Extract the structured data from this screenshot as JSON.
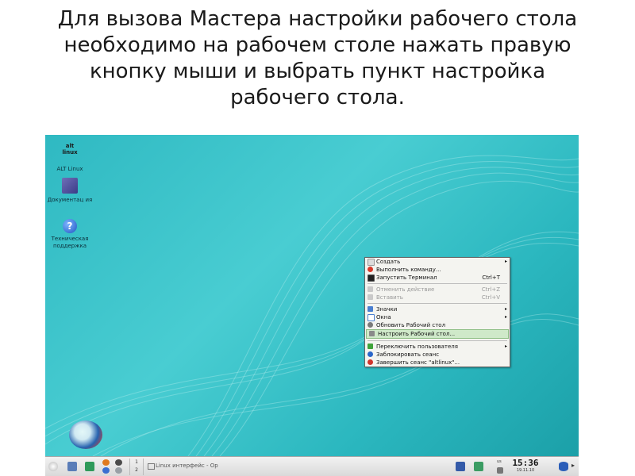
{
  "slide": {
    "title": "Для  вызова Мастера настройки рабочего стола\nнеобходимо на рабочем столе нажать правую\nкнопку мыши и выбрать пункт настройка\nрабочего стола."
  },
  "desktop": {
    "icons": [
      {
        "label": "ALT Linux",
        "icon": "altlinux-logo-icon",
        "logo_text": "alt linux"
      },
      {
        "label": "Документац ия",
        "icon": "book-icon"
      },
      {
        "label": "Техническая поддержка",
        "icon": "help-icon",
        "glyph": "?"
      }
    ]
  },
  "context_menu": {
    "items": [
      {
        "label": "Создать",
        "icon": "new-icon",
        "submenu": true
      },
      {
        "label": "Выполнить команду...",
        "icon": "run-icon"
      },
      {
        "label": "Запустить Терминал",
        "icon": "terminal-icon",
        "shortcut": "Ctrl+T"
      },
      {
        "label": "Отменить действие",
        "icon": "undo-icon",
        "shortcut": "Ctrl+Z",
        "disabled": true
      },
      {
        "label": "Вставить",
        "icon": "paste-icon",
        "shortcut": "Ctrl+V",
        "disabled": true
      },
      {
        "label": "Значки",
        "icon": "icons-icon",
        "submenu": true
      },
      {
        "label": "Окна",
        "icon": "windows-icon",
        "submenu": true
      },
      {
        "label": "Обновить Рабочий стол",
        "icon": "refresh-icon"
      },
      {
        "label": "Настроить Рабочий стол...",
        "icon": "configure-icon",
        "highlighted": true
      },
      {
        "label": "Переключить пользователя",
        "icon": "switch-user-icon",
        "submenu": true
      },
      {
        "label": "Заблокировать сеанс",
        "icon": "lock-icon"
      },
      {
        "label": "Завершить сеанс \"altlinux\"...",
        "icon": "logout-icon"
      }
    ]
  },
  "taskbar": {
    "pager": [
      "1",
      "2"
    ],
    "task": "Linux интерфейс - Ор",
    "lang": "us",
    "clock": {
      "time": "15:36",
      "date": "19.11.10"
    }
  },
  "colors": {
    "desktop": "#2fb9c2",
    "menu_bg": "#f4f4f0",
    "menu_highlight": "#cfe9c9"
  }
}
